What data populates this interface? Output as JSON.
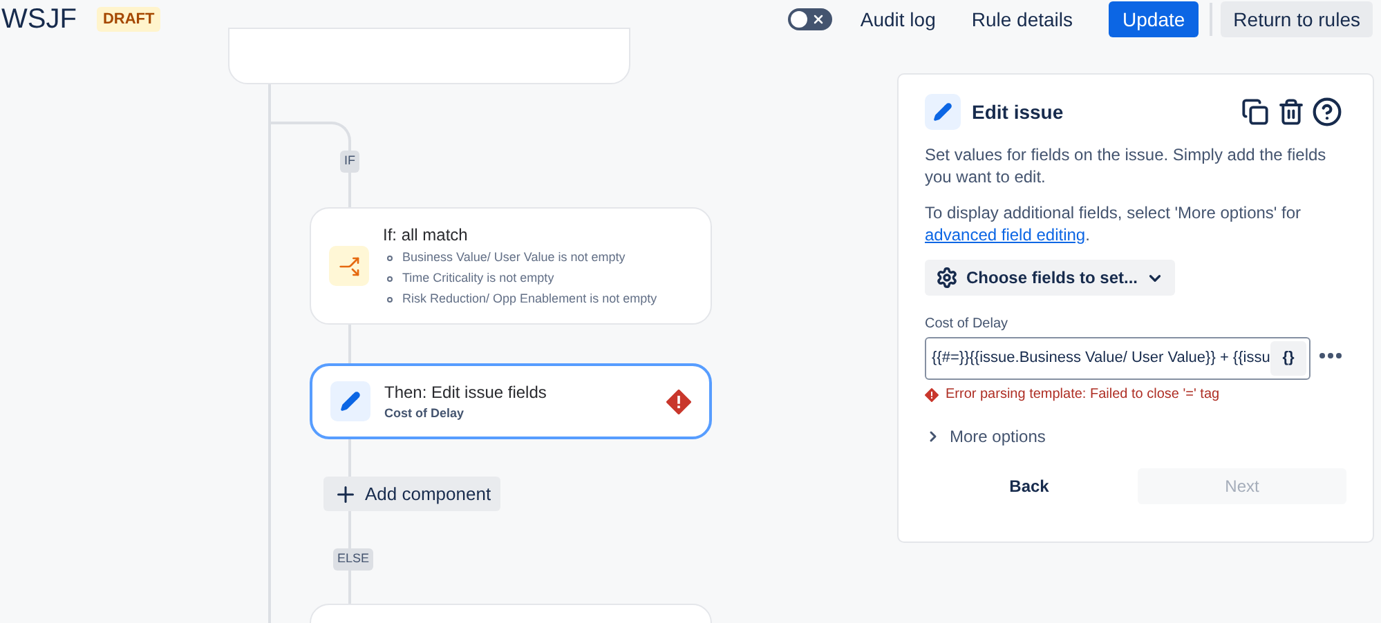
{
  "header": {
    "title": "WSJF",
    "badge": "DRAFT",
    "toggle": {
      "on": false
    },
    "links": [
      "Audit log",
      "Rule details"
    ],
    "primary_button": "Update",
    "secondary_button": "Return to rules"
  },
  "canvas": {
    "branch_labels": [
      "IF",
      "ELSE"
    ],
    "nodes": [
      {
        "kind": "condition",
        "title": "If: all match",
        "items": [
          "Business Value/ User Value is not empty",
          "Time Criticality is not empty",
          "Risk Reduction/ Opp Enablement is not empty"
        ],
        "selected": false,
        "error": false
      },
      {
        "kind": "action",
        "title": "Then: Edit issue fields",
        "subtitle": "Cost of Delay",
        "selected": true,
        "error": true
      }
    ],
    "add_button": "Add component"
  },
  "panel": {
    "title": "Edit issue",
    "description": "Set values for fields on the issue. Simply add the fields you want to edit.",
    "note": "To display additional fields, select 'More options' for",
    "note_link": "advanced field editing",
    "note_end": ".",
    "choose_button": "Choose fields to set...",
    "field": {
      "label": "Cost of Delay",
      "value": "{{#=}}{{issue.Business Value/ User Value}} + {{issu",
      "smart_button": "{}",
      "error": "Error parsing template: Failed to close '=' tag"
    },
    "more_options": {
      "label": "More options",
      "expanded": false
    },
    "back_button": "Back",
    "next_button": {
      "label": "Next",
      "disabled": true
    }
  }
}
